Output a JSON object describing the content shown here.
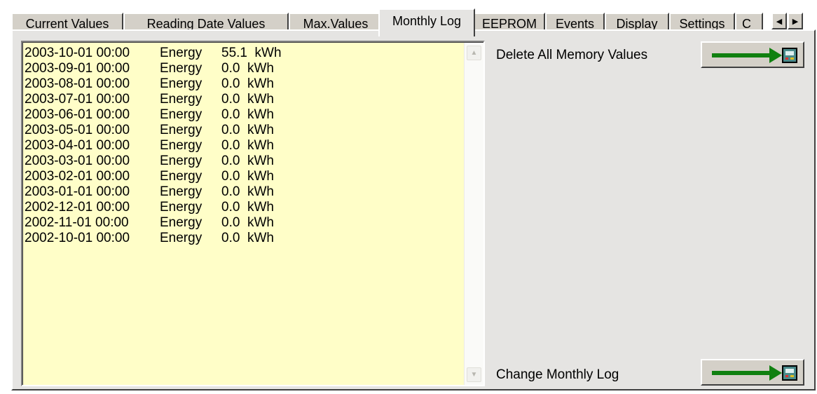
{
  "tabs": [
    {
      "label": "Current Values",
      "active": false
    },
    {
      "label": "Reading Date Values",
      "active": false
    },
    {
      "label": "Max.Values",
      "active": false
    },
    {
      "label": "Monthly Log",
      "active": true
    },
    {
      "label": "EEPROM",
      "active": false
    },
    {
      "label": "Events",
      "active": false
    },
    {
      "label": "Display",
      "active": false
    },
    {
      "label": "Settings",
      "active": false
    },
    {
      "label": "C",
      "active": false
    }
  ],
  "tab_scroll": {
    "left_icon": "arrow-left-icon",
    "right_icon": "arrow-right-icon"
  },
  "monthly_log": {
    "rows": [
      {
        "date": "2003-10-01 00:00",
        "type": "Energy",
        "value": "55.1  kWh"
      },
      {
        "date": "2003-09-01 00:00",
        "type": "Energy",
        "value": "0.0  kWh"
      },
      {
        "date": "2003-08-01 00:00",
        "type": "Energy",
        "value": "0.0  kWh"
      },
      {
        "date": "2003-07-01 00:00",
        "type": "Energy",
        "value": "0.0  kWh"
      },
      {
        "date": "2003-06-01 00:00",
        "type": "Energy",
        "value": "0.0  kWh"
      },
      {
        "date": "2003-05-01 00:00",
        "type": "Energy",
        "value": "0.0  kWh"
      },
      {
        "date": "2003-04-01 00:00",
        "type": "Energy",
        "value": "0.0  kWh"
      },
      {
        "date": "2003-03-01 00:00",
        "type": "Energy",
        "value": "0.0  kWh"
      },
      {
        "date": "2003-02-01 00:00",
        "type": "Energy",
        "value": "0.0  kWh"
      },
      {
        "date": "2003-01-01 00:00",
        "type": "Energy",
        "value": "0.0  kWh"
      },
      {
        "date": "2002-12-01 00:00",
        "type": "Energy",
        "value": "0.0  kWh"
      },
      {
        "date": "2002-11-01 00:00",
        "type": "Energy",
        "value": "0.0  kWh"
      },
      {
        "date": "2002-10-01 00:00",
        "type": "Energy",
        "value": "0.0  kWh"
      }
    ],
    "background_color": "#fffec8"
  },
  "actions": {
    "delete_all_label": "Delete All Memory Values",
    "change_log_label": "Change Monthly Log",
    "button_icon": "green-arrow-to-device-icon",
    "arrow_color": "#108010",
    "device_color": "#4a8a8a"
  }
}
